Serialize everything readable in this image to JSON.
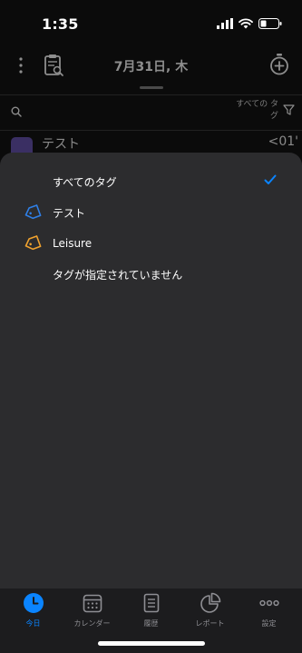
{
  "status_bar": {
    "time": "1:35"
  },
  "header": {
    "date_title": "7月31日, 木"
  },
  "search": {
    "tags_filter_label": "すべての タグ"
  },
  "background_list": {
    "row_title": "テスト",
    "row_time": "<01'"
  },
  "tag_sheet": {
    "options": [
      {
        "label": "すべてのタグ",
        "selected": true,
        "icon": ""
      },
      {
        "label": "テスト",
        "selected": false,
        "icon": "tag-icon",
        "color": "#2f7fe6"
      },
      {
        "label": "Leisure",
        "selected": false,
        "icon": "tag-icon",
        "color": "#f0a22e"
      },
      {
        "label": "タグが指定されていません",
        "selected": false,
        "icon": ""
      }
    ],
    "check_color": "#0a84ff"
  },
  "tab_bar": {
    "tabs": [
      {
        "label": "今日",
        "icon": "clock-icon",
        "active": true
      },
      {
        "label": "カレンダー",
        "icon": "calendar-icon",
        "active": false
      },
      {
        "label": "履歴",
        "icon": "list-document-icon",
        "active": false
      },
      {
        "label": "レポート",
        "icon": "pie-chart-icon",
        "active": false
      },
      {
        "label": "設定",
        "icon": "more-horizontal-icon",
        "active": false
      }
    ]
  },
  "colors": {
    "accent": "#0a84ff",
    "sheet_background": "#2c2c2e",
    "tab_bar_background": "#1c1c1e"
  }
}
